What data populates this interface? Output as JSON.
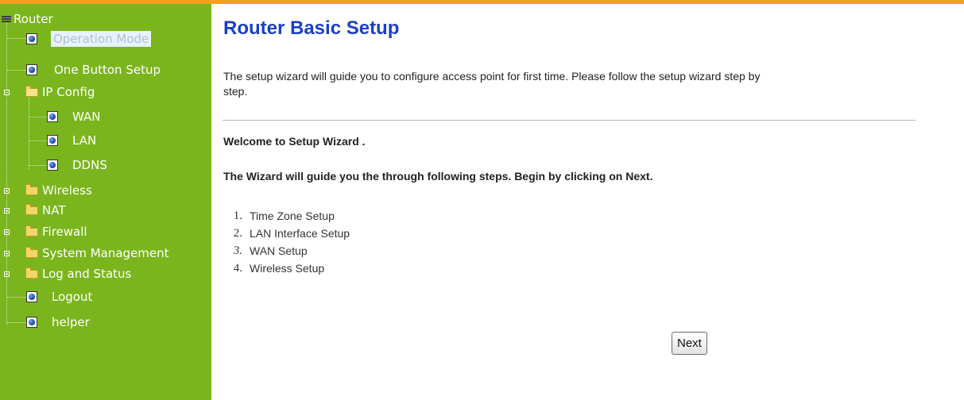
{
  "sidebar": {
    "root_label": "Router",
    "items": {
      "operation_mode": "Operation Mode",
      "one_button_setup": "One Button Setup",
      "ip_config": "IP Config",
      "wan": "WAN",
      "lan": "LAN",
      "ddns": "DDNS",
      "wireless": "Wireless",
      "nat": "NAT",
      "firewall": "Firewall",
      "system_management": "System Management",
      "log_and_status": "Log and Status",
      "logout": "Logout",
      "helper": "helper"
    },
    "selected": "operation_mode",
    "colors": {
      "background": "#7ab51d",
      "text": "#ffffff"
    }
  },
  "main": {
    "title": "Router Basic Setup",
    "intro_line1": "The setup wizard will guide you to configure access point for first time. Please follow the setup wizard step by",
    "intro_line2": "step.",
    "welcome": "Welcome to Setup Wizard .",
    "guide": "The Wizard will guide you the through following steps. Begin by clicking on Next.",
    "steps": [
      {
        "number": "1.",
        "label": "Time Zone Setup"
      },
      {
        "number": "2.",
        "label": "LAN Interface Setup"
      },
      {
        "number": "3.",
        "label": "WAN Setup"
      },
      {
        "number": "4.",
        "label": "Wireless Setup"
      }
    ],
    "next_label": "Next",
    "colors": {
      "title": "#1a3fc8",
      "top_bar": "#f0a020"
    }
  }
}
